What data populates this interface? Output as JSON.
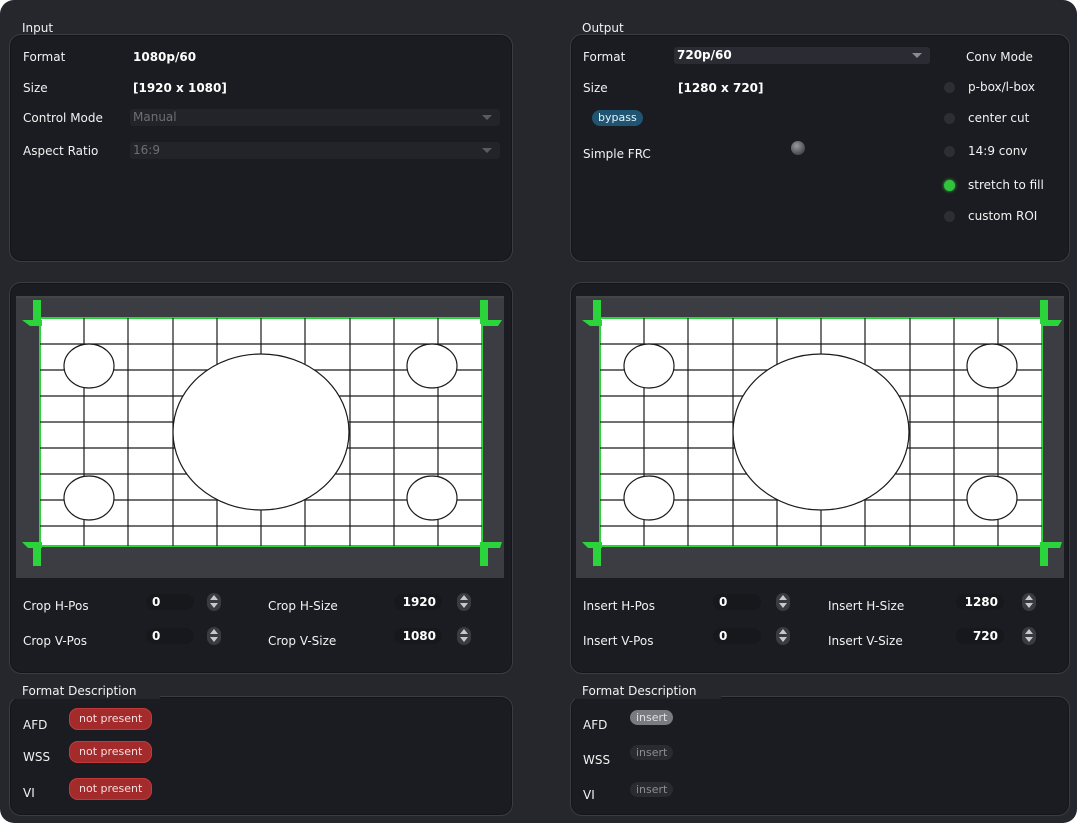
{
  "input": {
    "section_title": "Input",
    "format_label": "Format",
    "format_value": "1080p/60",
    "size_label": "Size",
    "size_value": "[1920 x 1080]",
    "control_mode_label": "Control Mode",
    "control_mode_value": "Manual",
    "aspect_ratio_label": "Aspect Ratio",
    "aspect_ratio_value": "16:9",
    "crop_hpos_label": "Crop H-Pos",
    "crop_hpos_value": "0",
    "crop_vpos_label": "Crop V-Pos",
    "crop_vpos_value": "0",
    "crop_hsize_label": "Crop H-Size",
    "crop_hsize_value": "1920",
    "crop_vsize_label": "Crop V-Size",
    "crop_vsize_value": "1080",
    "format_description_title": "Format Description",
    "afd_label": "AFD",
    "afd_status": "not present",
    "wss_label": "WSS",
    "wss_status": "not present",
    "vi_label": "VI",
    "vi_status": "not present"
  },
  "output": {
    "section_title": "Output",
    "format_label": "Format",
    "format_value": "720p/60",
    "size_label": "Size",
    "size_value": "[1280 x 720]",
    "bypass_label": "bypass",
    "simple_frc_label": "Simple FRC",
    "conv_mode_title": "Conv Mode",
    "conv_modes": [
      {
        "label": "p-box/l-box",
        "selected": false
      },
      {
        "label": "center cut",
        "selected": false
      },
      {
        "label": "14:9 conv",
        "selected": false
      },
      {
        "label": "stretch to fill",
        "selected": true
      },
      {
        "label": "custom ROI",
        "selected": false
      }
    ],
    "insert_hpos_label": "Insert H-Pos",
    "insert_hpos_value": "0",
    "insert_vpos_label": "Insert V-Pos",
    "insert_vpos_value": "0",
    "insert_hsize_label": "Insert H-Size",
    "insert_hsize_value": "1280",
    "insert_vsize_label": "Insert V-Size",
    "insert_vsize_value": "720",
    "format_description_title": "Format Description",
    "afd_label": "AFD",
    "afd_status": "insert",
    "wss_label": "WSS",
    "wss_status": "insert",
    "vi_label": "VI",
    "vi_status": "insert"
  },
  "colors": {
    "accent_green": "#2ec43b",
    "not_present_red": "#a42b2b",
    "bypass_blue": "#1f5570"
  }
}
